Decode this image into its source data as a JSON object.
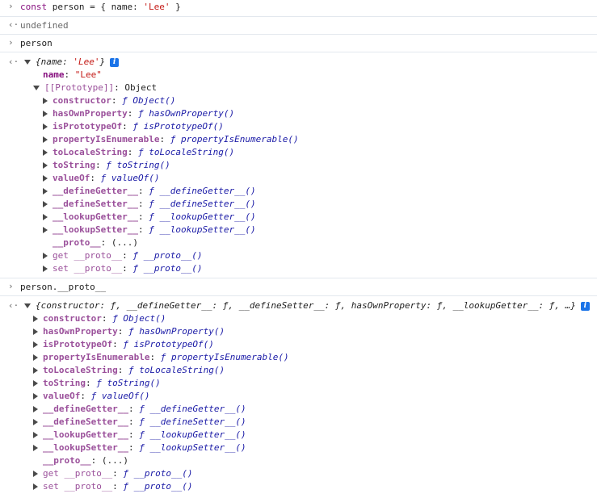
{
  "gutter": {
    "input": "›",
    "output": "‹·"
  },
  "cmd1": {
    "kw": "const",
    "rest": " person = { name: ",
    "str": "'Lee'",
    "end": " }"
  },
  "res1": "undefined",
  "cmd2": "person",
  "obj": {
    "summary_open": "{name: ",
    "summary_str": "'Lee'",
    "summary_close": "}",
    "name_key": "name",
    "name_val": "\"Lee\"",
    "proto_key": "[[Prototype]]",
    "proto_val": ": Object"
  },
  "cmd3": "person.__proto__",
  "summary2": "{constructor: ƒ, __defineGetter__: ƒ, __defineSetter__: ƒ, hasOwnProperty: ƒ, __lookupGetter__: ƒ, …}",
  "proto_items": [
    {
      "key": "constructor",
      "val": "ƒ Object()"
    },
    {
      "key": "hasOwnProperty",
      "val": "ƒ hasOwnProperty()"
    },
    {
      "key": "isPrototypeOf",
      "val": "ƒ isPrototypeOf()"
    },
    {
      "key": "propertyIsEnumerable",
      "val": "ƒ propertyIsEnumerable()"
    },
    {
      "key": "toLocaleString",
      "val": "ƒ toLocaleString()"
    },
    {
      "key": "toString",
      "val": "ƒ toString()"
    },
    {
      "key": "valueOf",
      "val": "ƒ valueOf()"
    },
    {
      "key": "__defineGetter__",
      "val": "ƒ __defineGetter__()"
    },
    {
      "key": "__defineSetter__",
      "val": "ƒ __defineSetter__()"
    },
    {
      "key": "__lookupGetter__",
      "val": "ƒ __lookupGetter__()"
    },
    {
      "key": "__lookupSetter__",
      "val": "ƒ __lookupSetter__()"
    }
  ],
  "proto_tail": {
    "proto_key": "__proto__",
    "proto_val": "(...)",
    "get_key": "get __proto__",
    "get_val": "ƒ __proto__()",
    "set_key": "set __proto__",
    "set_val": "ƒ __proto__()"
  }
}
